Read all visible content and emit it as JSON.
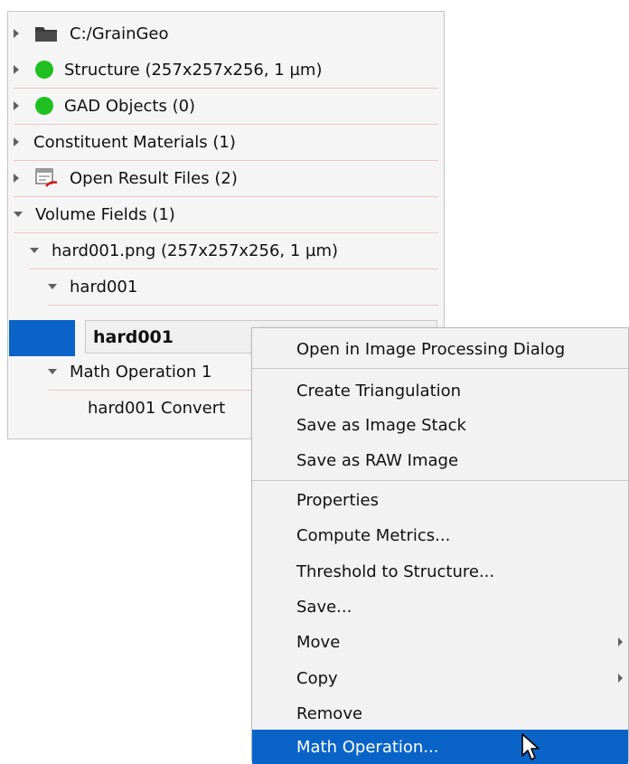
{
  "tree": {
    "items": [
      {
        "label": "C:/GrainGeo",
        "icon": "folder-icon",
        "expanded": false
      },
      {
        "label": "Structure (257x257x256, 1 µm)",
        "icon": "green-dot-icon",
        "expanded": false
      },
      {
        "label": "GAD Objects (0)",
        "icon": "green-dot-icon",
        "expanded": false
      },
      {
        "label": "Constituent Materials (1)",
        "expanded": false
      },
      {
        "label": "Open Result Files (2)",
        "icon": "result-files-icon",
        "expanded": false
      },
      {
        "label": "Volume Fields (1)",
        "expanded": true
      },
      {
        "label": "hard001.png (257x257x256, 1 µm)",
        "expanded": true
      },
      {
        "label": "hard001",
        "expanded": true
      },
      {
        "label": "hard001",
        "selected": true
      },
      {
        "label": "Math Operation 1",
        "expanded": true
      },
      {
        "label": "hard001 Convert"
      }
    ]
  },
  "context_menu": {
    "items": [
      {
        "label": "Open in Image Processing Dialog"
      },
      {
        "label": "Create Triangulation"
      },
      {
        "label": "Save as Image Stack"
      },
      {
        "label": "Save as RAW Image"
      },
      {
        "label": "Properties"
      },
      {
        "label": "Compute Metrics..."
      },
      {
        "label": "Threshold to Structure..."
      },
      {
        "label": "Save..."
      },
      {
        "label": "Move",
        "submenu": true
      },
      {
        "label": "Copy",
        "submenu": true
      },
      {
        "label": "Remove"
      },
      {
        "label": "Math Operation...",
        "highlighted": true
      }
    ]
  },
  "colors": {
    "selection": "#0a64c8",
    "status_green": "#1fc01f",
    "panel_bg": "#f5f5f5",
    "menu_bg": "#f2f2f2"
  }
}
